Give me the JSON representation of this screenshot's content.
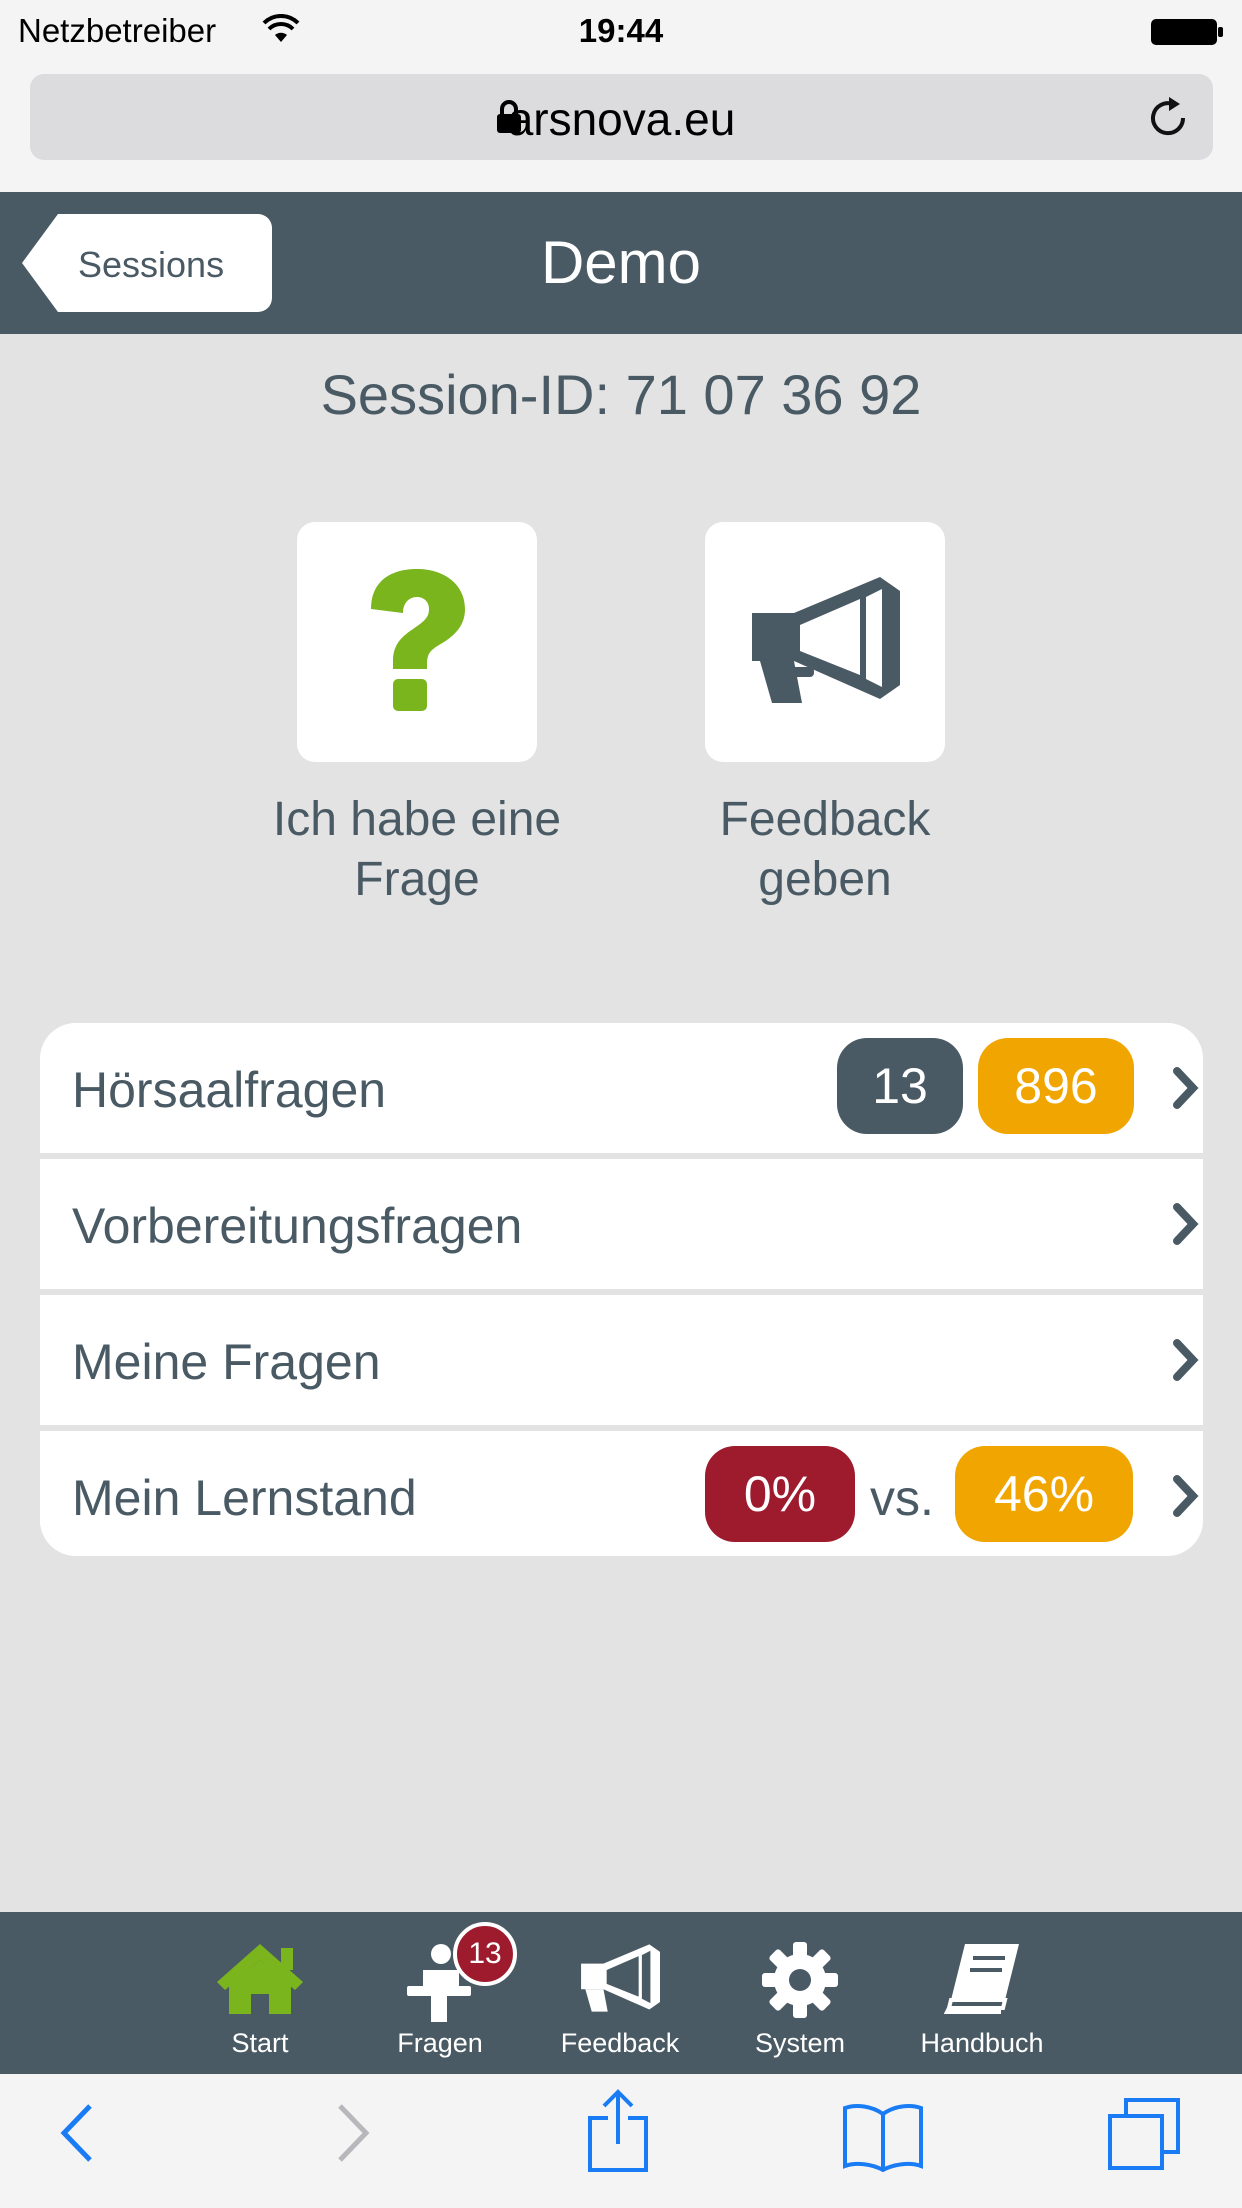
{
  "status": {
    "carrier": "Netzbetreiber",
    "time": "19:44"
  },
  "browser": {
    "domain": "arsnova.eu"
  },
  "header": {
    "back_label": "Sessions",
    "title": "Demo"
  },
  "session": {
    "id_text": "Session-ID: 71 07 36 92"
  },
  "tiles": [
    {
      "label_line1": "Ich habe eine",
      "label_line2": "Frage",
      "icon": "question-icon"
    },
    {
      "label_line1": "Feedback",
      "label_line2": "geben",
      "icon": "megaphone-icon"
    }
  ],
  "list": {
    "rows": [
      {
        "label": "Hörsaalfragen",
        "badges": [
          "13",
          "896"
        ]
      },
      {
        "label": "Vorbereitungsfragen"
      },
      {
        "label": "Meine Fragen"
      },
      {
        "label": "Mein Lernstand",
        "badges": [
          "0%",
          "46%"
        ],
        "separator": "vs."
      }
    ]
  },
  "tabbar": {
    "items": [
      {
        "label": "Start",
        "icon": "home-icon"
      },
      {
        "label": "Fragen",
        "icon": "lecturer-icon",
        "badge": "13"
      },
      {
        "label": "Feedback",
        "icon": "megaphone-icon"
      },
      {
        "label": "System",
        "icon": "gear-icon"
      },
      {
        "label": "Handbuch",
        "icon": "book-icon"
      }
    ]
  },
  "colors": {
    "primary": "#4a5a64",
    "accent_green": "#7ab51d",
    "orange": "#f0a500",
    "red": "#9e1b2e",
    "background": "#e3e3e3",
    "ios_blue": "#1a7cf5"
  }
}
